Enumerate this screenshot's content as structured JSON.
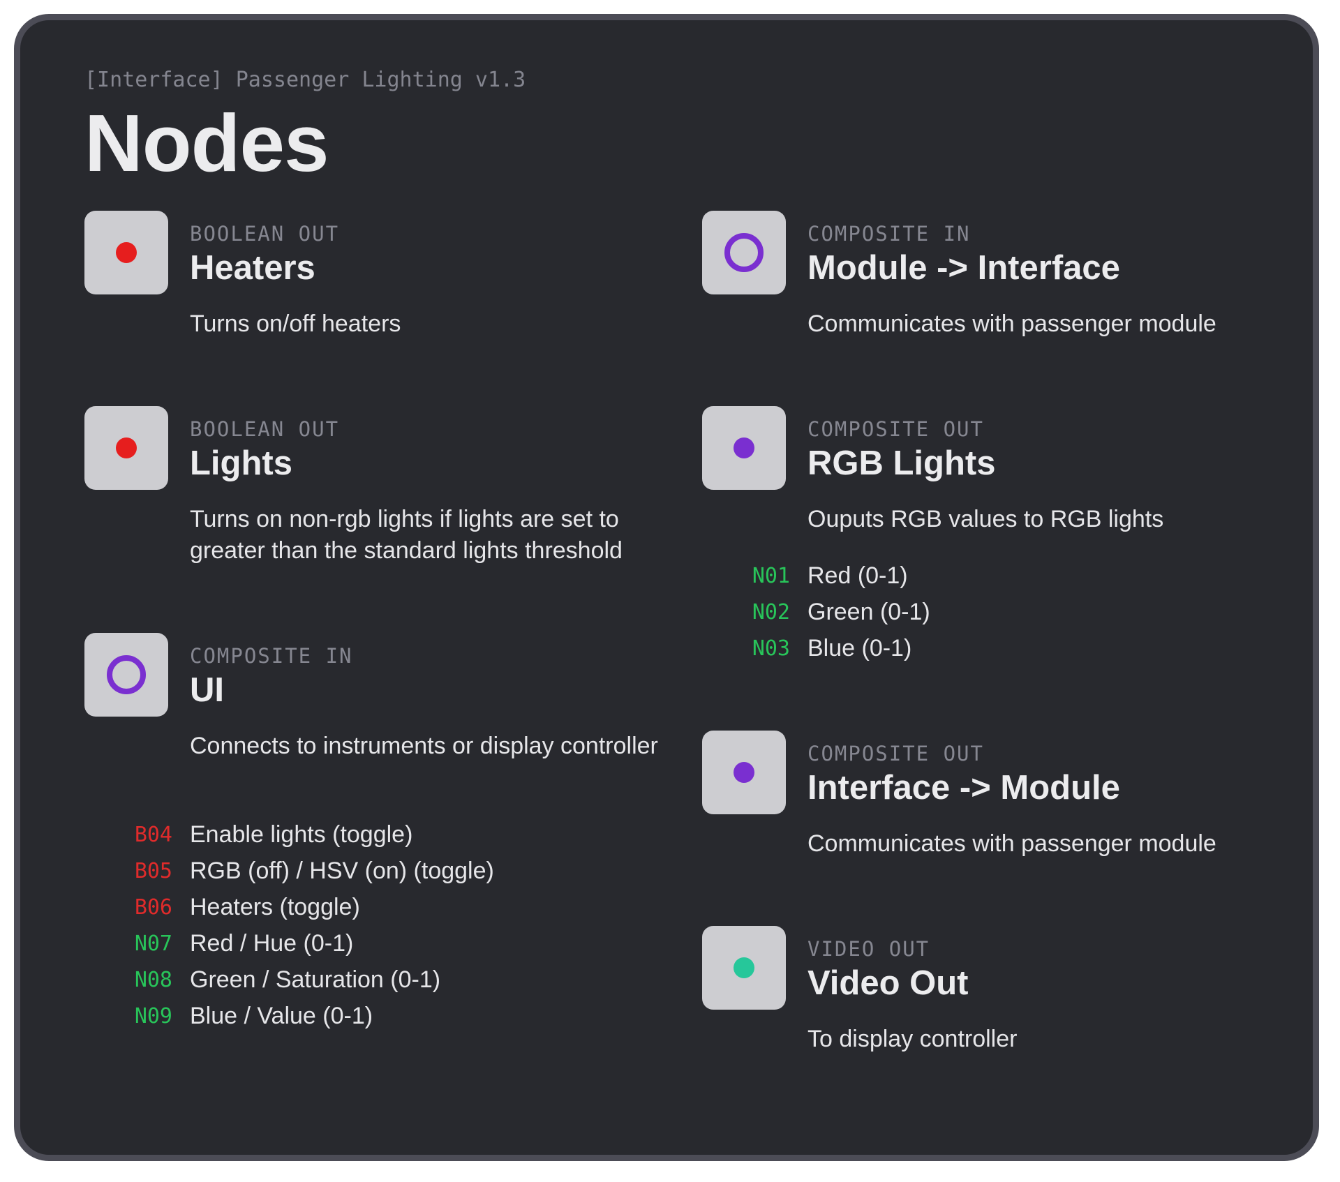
{
  "header": {
    "subtitle": "[Interface] Passenger Lighting v1.3",
    "title": "Nodes"
  },
  "colors": {
    "boolean": "#e61e1e",
    "composite": "#7a2fd0",
    "video": "#26c79a",
    "code_boolean": "#e02b2b",
    "code_number": "#28c55a"
  },
  "nodes": {
    "heaters": {
      "icon": "filled-dot-icon",
      "type": "BOOLEAN OUT",
      "name": "Heaters",
      "description": "Turns on/off heaters"
    },
    "lights": {
      "icon": "filled-dot-icon",
      "type": "BOOLEAN OUT",
      "name": "Lights",
      "description": "Turns on non-rgb lights if lights are set to greater than the standard lights threshold"
    },
    "ui": {
      "icon": "ring-icon",
      "type": "COMPOSITE IN",
      "name": "UI",
      "description": "Connects to instruments or display controller",
      "ports": [
        {
          "code": "B04",
          "label": "Enable lights (toggle)"
        },
        {
          "code": "B05",
          "label": "RGB (off) / HSV (on) (toggle)"
        },
        {
          "code": "B06",
          "label": "Heaters (toggle)"
        },
        {
          "code": "N07",
          "label": "Red / Hue (0-1)"
        },
        {
          "code": "N08",
          "label": "Green / Saturation (0-1)"
        },
        {
          "code": "N09",
          "label": "Blue / Value (0-1)"
        }
      ]
    },
    "module_to_interface": {
      "icon": "ring-icon",
      "type": "COMPOSITE IN",
      "name": "Module -> Interface",
      "description": "Communicates with passenger module"
    },
    "rgb_lights": {
      "icon": "filled-dot-icon",
      "type": "COMPOSITE OUT",
      "name": "RGB Lights",
      "description": "Ouputs RGB values to RGB lights",
      "ports": [
        {
          "code": "N01",
          "label": "Red (0-1)"
        },
        {
          "code": "N02",
          "label": "Green (0-1)"
        },
        {
          "code": "N03",
          "label": "Blue (0-1)"
        }
      ]
    },
    "interface_to_module": {
      "icon": "filled-dot-icon",
      "type": "COMPOSITE OUT",
      "name": "Interface -> Module",
      "description": "Communicates with passenger module"
    },
    "video_out": {
      "icon": "filled-dot-icon",
      "type": "VIDEO OUT",
      "name": "Video Out",
      "description": "To display controller"
    }
  }
}
